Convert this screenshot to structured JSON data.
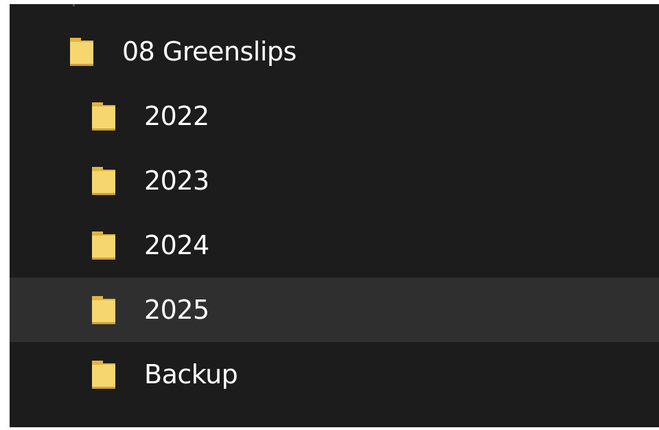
{
  "tree": {
    "parent": {
      "label": "08 Greenslips",
      "icon": "folder-icon"
    },
    "children": [
      {
        "label": "2022",
        "icon": "folder-icon",
        "selected": false
      },
      {
        "label": "2023",
        "icon": "folder-icon",
        "selected": false
      },
      {
        "label": "2024",
        "icon": "folder-icon",
        "selected": false
      },
      {
        "label": "2025",
        "icon": "folder-icon",
        "selected": true
      },
      {
        "label": "Backup",
        "icon": "folder-icon",
        "selected": false
      }
    ]
  },
  "colors": {
    "background": "#1c1c1c",
    "selected_row": "#2f2f2f",
    "folder_front": "#f6d66f",
    "folder_back": "#e3b33e",
    "text": "#ffffff"
  }
}
